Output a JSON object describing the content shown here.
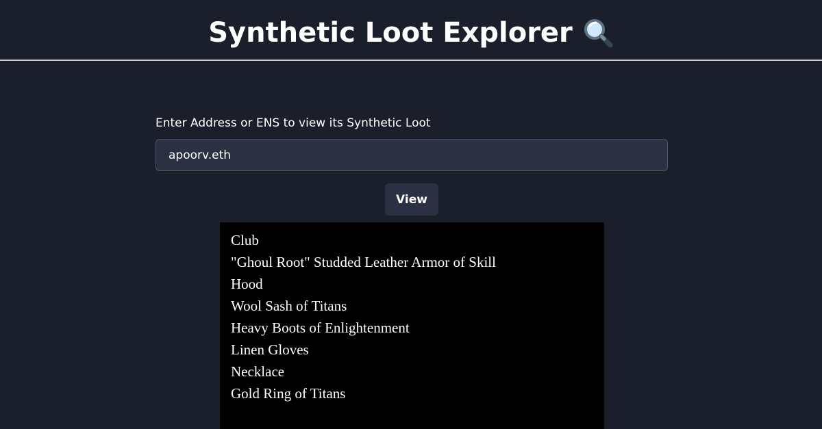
{
  "header": {
    "title": "Synthetic Loot Explorer",
    "title_icon": "magnifying-glass-icon"
  },
  "form": {
    "label": "Enter Address or ENS to view its Synthetic Loot",
    "input_value": "apoorv.eth",
    "button_label": "View"
  },
  "loot": {
    "items": [
      "Club",
      "\"Ghoul Root\" Studded Leather Armor of Skill",
      "Hood",
      "Wool Sash of Titans",
      "Heavy Boots of Enlightenment",
      "Linen Gloves",
      "Necklace",
      "Gold Ring of Titans"
    ]
  },
  "colors": {
    "background": "#1b1f2b",
    "input_background": "#2b3142",
    "loot_panel": "#000000",
    "text": "#ffffff"
  }
}
